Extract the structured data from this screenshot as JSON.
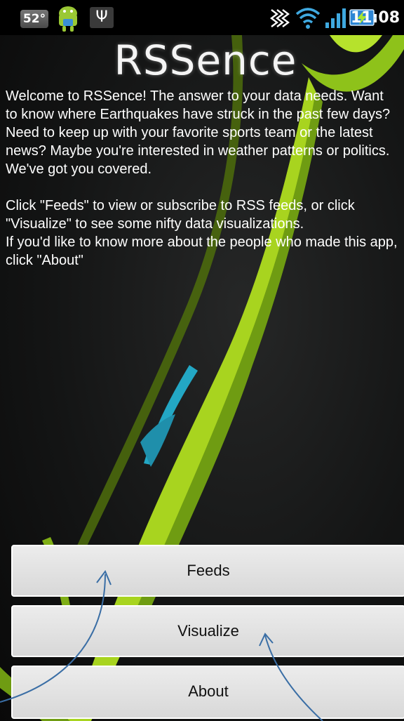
{
  "statusbar": {
    "temperature": "52°",
    "time": "11:08",
    "icons": [
      "android-robot-icon",
      "usb-icon",
      "vibrate-icon",
      "wifi-icon",
      "signal-icon",
      "battery-charging-icon"
    ]
  },
  "app": {
    "title": "RSSence",
    "welcome_text": "Welcome to RSSence! The answer to your data needs.  Want to know where Earthquakes have struck in the past few days? Need to keep up with your favorite sports team or the latest news? Maybe you're interested in weather patterns or politics. We've got you covered.\n\nClick \"Feeds\" to view or subscribe to RSS feeds, or click \"Visualize\" to see some nifty data visualizations.\nIf you'd like to know more about the people who made this app, click \"About\""
  },
  "buttons": {
    "feeds": "Feeds",
    "visualize": "Visualize",
    "about": "About"
  },
  "colors": {
    "accent_green": "#9acd1a",
    "accent_cyan": "#23a7c4",
    "button_bg": "#e0e0e0",
    "annotation_blue": "#3a6ea5"
  }
}
